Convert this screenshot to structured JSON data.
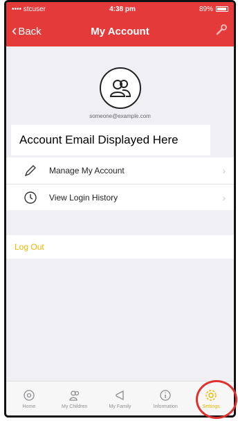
{
  "status_bar": {
    "carrier": "•••• stcuser",
    "time": "4:38 pm",
    "battery": "89%"
  },
  "nav": {
    "back_label": "Back",
    "title": "My Account",
    "right_icon": "tool-icon"
  },
  "profile": {
    "avatar_icon": "users-icon",
    "email": "someone@example.com"
  },
  "overlay_label": "Account Email Displayed Here",
  "menu": [
    {
      "label": "Manage My Account",
      "icon": "pencil-icon"
    },
    {
      "label": "View Login History",
      "icon": "clock-icon"
    }
  ],
  "logout_label": "Log Out",
  "tabs": [
    {
      "label": "Home",
      "icon": "home-icon"
    },
    {
      "label": "My Children",
      "icon": "children-icon"
    },
    {
      "label": "My Family",
      "icon": "megaphone-icon"
    },
    {
      "label": "Information",
      "icon": "info-icon"
    },
    {
      "label": "Settings",
      "icon": "gear-icon",
      "active": true
    }
  ],
  "colors": {
    "header": "#e43a3a",
    "accent": "#f0b400",
    "highlight_ring": "#e03030"
  }
}
